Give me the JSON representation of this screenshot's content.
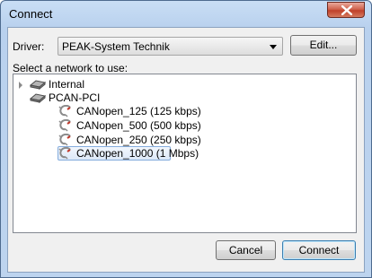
{
  "window": {
    "title": "Connect"
  },
  "driver": {
    "label": "Driver:",
    "selected": "PEAK-System Technik",
    "edit_label": "Edit..."
  },
  "network": {
    "label": "Select a network to use:",
    "tree": [
      {
        "label": "Internal",
        "expanded": false
      },
      {
        "label": "PCAN-PCI",
        "expanded": true,
        "children": [
          {
            "label": "CANopen_125 (125 kbps)"
          },
          {
            "label": "CANopen_500 (500 kbps)"
          },
          {
            "label": "CANopen_250 (250 kbps)"
          },
          {
            "label": "CANopen_1000 (1 Mbps)",
            "selected": true
          }
        ]
      }
    ]
  },
  "buttons": {
    "cancel": "Cancel",
    "connect": "Connect"
  },
  "colors": {
    "selection_border": "#84acdd",
    "close_button": "#c0402a"
  }
}
